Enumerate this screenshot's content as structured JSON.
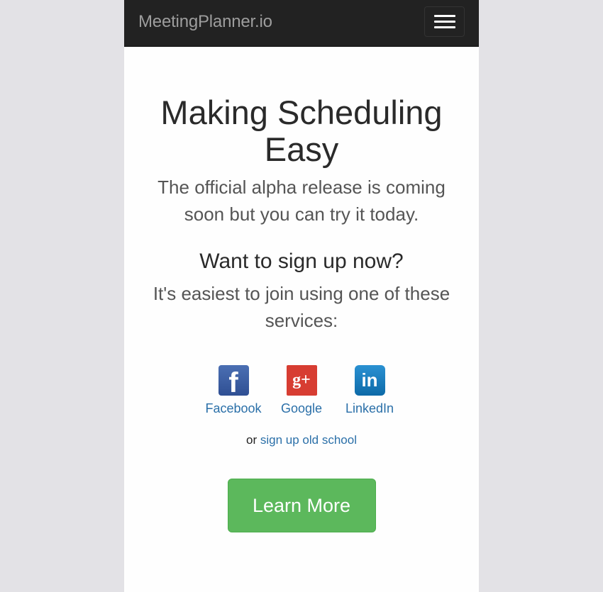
{
  "navbar": {
    "brand": "MeetingPlanner.io",
    "menu_icon": "hamburger-menu-icon"
  },
  "hero": {
    "title": "Making Scheduling Easy",
    "lead": "The official alpha release is coming soon but you can try it today."
  },
  "signup": {
    "heading": "Want to sign up now?",
    "subtext": "It's easiest to join using one of these services:",
    "services": [
      {
        "label": "Facebook",
        "icon": "facebook-icon",
        "glyph": "f",
        "color": "#3b5998"
      },
      {
        "label": "Google",
        "icon": "google-plus-icon",
        "glyph": "g+",
        "color": "#d73d32"
      },
      {
        "label": "LinkedIn",
        "icon": "linkedin-icon",
        "glyph": "in",
        "color": "#0e76a8"
      }
    ],
    "alt_prefix": "or",
    "alt_link": "sign up old school",
    "link_color": "#2a6fa8"
  },
  "cta": {
    "label": "Learn More",
    "color": "#5cb85c"
  }
}
